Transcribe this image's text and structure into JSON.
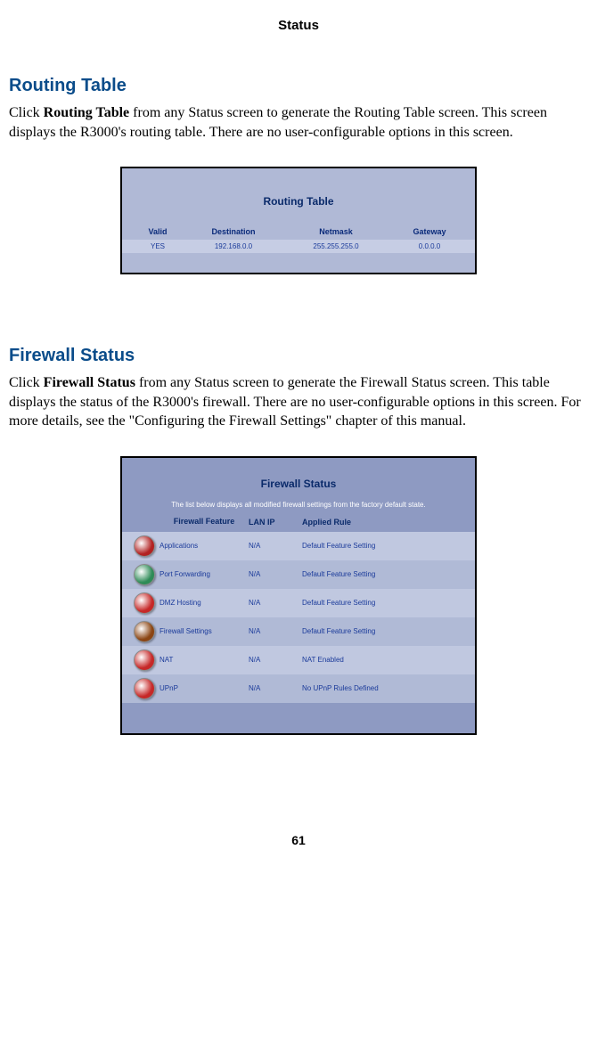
{
  "page_header": "Status",
  "page_number": "61",
  "routing": {
    "heading": "Routing Table",
    "para_pre": "Click ",
    "para_bold": "Routing Table",
    "para_post": " from any Status screen to generate the Routing Table screen. This screen displays the R3000's routing table. There are no user-configurable options in this screen.",
    "fig_title": "Routing Table",
    "cols": {
      "c1": "Valid",
      "c2": "Destination",
      "c3": "Netmask",
      "c4": "Gateway"
    },
    "row": {
      "c1": "YES",
      "c2": "192.168.0.0",
      "c3": "255.255.255.0",
      "c4": "0.0.0.0"
    }
  },
  "firewall": {
    "heading": "Firewall Status",
    "para_pre": "Click ",
    "para_bold": "Firewall Status",
    "para_post": " from any Status screen to generate the Firewall Status screen. This table displays the status of the R3000's firewall. There are no user-configurable options in this screen. For more details, see the \"Configuring the Firewall Settings\" chapter of this manual.",
    "fig_title": "Firewall Status",
    "subtext": "The list below displays all modified firewall settings from the factory default state.",
    "cols": {
      "icon": "",
      "feature": "Firewall Feature",
      "lan": "LAN IP",
      "rule": "Applied Rule"
    },
    "rows": [
      {
        "icon_name": "applications-icon",
        "icon_color": "#b22222",
        "feature": "Applications",
        "lan": "N/A",
        "rule": "Default Feature Setting"
      },
      {
        "icon_name": "port-forwarding-icon",
        "icon_color": "#2e8b57",
        "feature": "Port Forwarding",
        "lan": "N/A",
        "rule": "Default Feature Setting"
      },
      {
        "icon_name": "dmz-hosting-icon",
        "icon_color": "#c62828",
        "feature": "DMZ Hosting",
        "lan": "N/A",
        "rule": "Default Feature Setting"
      },
      {
        "icon_name": "firewall-settings-icon",
        "icon_color": "#8b4513",
        "feature": "Firewall Settings",
        "lan": "N/A",
        "rule": "Default Feature Setting"
      },
      {
        "icon_name": "nat-icon",
        "icon_color": "#c62828",
        "feature": "NAT",
        "lan": "N/A",
        "rule": "NAT Enabled"
      },
      {
        "icon_name": "upnp-icon",
        "icon_color": "#c62828",
        "feature": "UPnP",
        "lan": "N/A",
        "rule": "No UPnP Rules Defined"
      }
    ]
  }
}
